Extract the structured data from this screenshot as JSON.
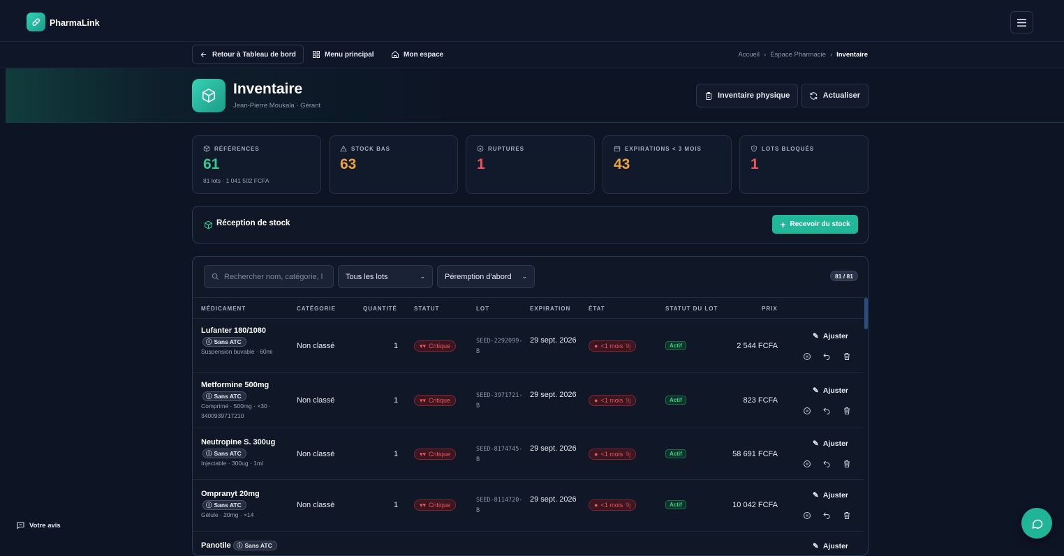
{
  "app": {
    "name": "PharmaLink"
  },
  "nav": {
    "back_label": "Retour à Tableau de bord",
    "menu_label": "Menu principal",
    "space_label": "Mon espace",
    "breadcrumb": [
      "Accueil",
      "Espace Pharmacie",
      "Inventaire"
    ]
  },
  "header": {
    "title": "Inventaire",
    "subtitle": "Jean-Pierre Moukala · Gérant",
    "physical_btn": "Inventaire physique",
    "refresh_btn": "Actualiser"
  },
  "stats": [
    {
      "label": "RÉFÉRENCES",
      "value": "61",
      "sub": "81 lots · 1 041 502 FCFA",
      "color": "#34c98f",
      "icon": "box-icon"
    },
    {
      "label": "STOCK BAS",
      "value": "63",
      "sub": "",
      "color": "#f0a23a",
      "icon": "warning-icon"
    },
    {
      "label": "RUPTURES",
      "value": "1",
      "sub": "",
      "color": "#f2545b",
      "icon": "package-x-icon"
    },
    {
      "label": "EXPIRATIONS < 3 MOIS",
      "value": "43",
      "sub": "",
      "color": "#f0a23a",
      "icon": "calendar-icon"
    },
    {
      "label": "LOTS BLOQUÉS",
      "value": "1",
      "sub": "",
      "color": "#f2545b",
      "icon": "shield-icon"
    }
  ],
  "reception": {
    "title": "Réception de stock",
    "button": "Recevoir du stock"
  },
  "filters": {
    "search_placeholder": "Rechercher nom, catégorie, l",
    "lots_select": "Tous les lots",
    "sort_select": "Péremption d'abord",
    "count": "81 / 81"
  },
  "table": {
    "columns": [
      "MÉDICAMENT",
      "CATÉGORIE",
      "QUANTITÉ",
      "STATUT",
      "LOT",
      "EXPIRATION",
      "ÉTAT",
      "STATUT DU LOT",
      "PRIX"
    ],
    "rows": [
      {
        "name": "Lufanter 180/1080",
        "atc": "Sans ATC",
        "desc": "Suspension buvable · 60ml",
        "category": "Non classé",
        "qty": "1",
        "status": "Critique",
        "lot": "SEED-2292099-B",
        "expiry": "29 sept. 2026",
        "etat": "<1 mois",
        "etat_days": "9j",
        "lot_status": "Actif",
        "price": "2 544 FCFA",
        "adjust": "Ajuster"
      },
      {
        "name": "Metformine 500mg",
        "atc": "Sans ATC",
        "desc": "Comprimé · 500mg · ×30 · 3400939717210",
        "category": "Non classé",
        "qty": "1",
        "status": "Critique",
        "lot": "SEED-3971721-B",
        "expiry": "29 sept. 2026",
        "etat": "<1 mois",
        "etat_days": "9j",
        "lot_status": "Actif",
        "price": "823 FCFA",
        "adjust": "Ajuster"
      },
      {
        "name": "Neutropine S. 300ug",
        "atc": "Sans ATC",
        "desc": "Injectable · 300ug · 1ml",
        "category": "Non classé",
        "qty": "1",
        "status": "Critique",
        "lot": "SEED-8174745-B",
        "expiry": "29 sept. 2026",
        "etat": "<1 mois",
        "etat_days": "9j",
        "lot_status": "Actif",
        "price": "58 691 FCFA",
        "adjust": "Ajuster"
      },
      {
        "name": "Ompranyt 20mg",
        "atc": "Sans ATC",
        "desc": "Gélule · 20mg · ×14",
        "category": "Non classé",
        "qty": "1",
        "status": "Critique",
        "lot": "SEED-8114720-B",
        "expiry": "29 sept. 2026",
        "etat": "<1 mois",
        "etat_days": "9j",
        "lot_status": "Actif",
        "price": "10 042 FCFA",
        "adjust": "Ajuster"
      },
      {
        "name": "Panotile",
        "atc": "Sans ATC",
        "adjust": "Ajuster"
      }
    ]
  },
  "feedback": {
    "label": "Votre avis"
  }
}
